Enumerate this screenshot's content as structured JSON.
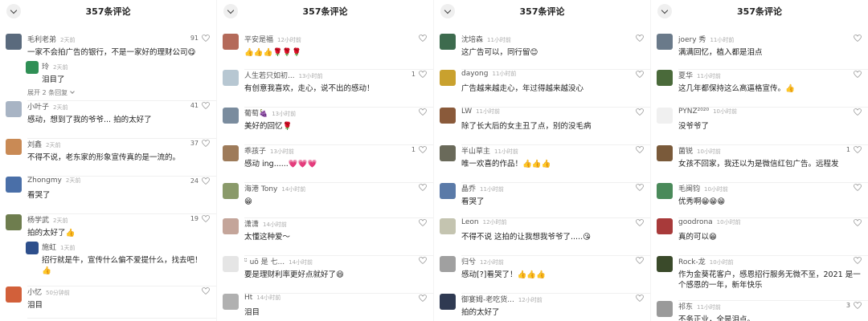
{
  "panels": [
    {
      "title": "357条评论",
      "comments": [
        {
          "user": "毛利老弟",
          "time": "2天前",
          "text": "一家不会拍广告的银行，不是一家好的理财公司😋",
          "likes": "91",
          "avatar_color": "#5a6a7d",
          "height": 84,
          "reply": {
            "user": "玲",
            "time": "2天前",
            "text": "泪目了",
            "avatar_color": "#2f8f55"
          },
          "expand": "展开 2 条回复"
        },
        {
          "user": "小叶子",
          "time": "2天前",
          "text": "感动，想到了我的爷爷... 拍的太好了",
          "likes": "41",
          "avatar_color": "#a8b4c4",
          "height": 47
        },
        {
          "user": "刘鑫",
          "time": "2天前",
          "text": "不得不说，老东家的形象宣传真的是一流的。",
          "likes": "37",
          "avatar_color": "#c98a55",
          "height": 47
        },
        {
          "user": "Zhongmy",
          "time": "2天前",
          "text": "看哭了",
          "likes": "24",
          "avatar_color": "#4a6fa8",
          "height": 47
        },
        {
          "user": "杨学武",
          "time": "2天前",
          "text": "拍的太好了👍",
          "likes": "19",
          "avatar_color": "#6e7d4e",
          "height": 90,
          "reply": {
            "user": "施虹",
            "time": "1天前",
            "text": "招行就是牛，宣传什么偏不爱提什么，找去吧！👍",
            "avatar_color": "#2d4f8c"
          }
        },
        {
          "user": "小忆",
          "time": "50分钟前",
          "text": "泪目",
          "likes": "",
          "avatar_color": "#d2603a",
          "height": 40
        }
      ]
    },
    {
      "title": "357条评论",
      "comments": [
        {
          "user": "平安是福",
          "time": "12小时前",
          "text": "👍👍👍🌹🌹🌹",
          "likes": "",
          "avatar_color": "#b46a5a",
          "height": 45
        },
        {
          "user": "人生若只如初...",
          "time": "13小时前",
          "text": "有创意我喜欢，走心，说不出的感动！",
          "likes": "1",
          "avatar_color": "#b7c7d2",
          "height": 47
        },
        {
          "user": "葡萄🍇",
          "time": "13小时前",
          "text": "美好的回忆🌹",
          "likes": "",
          "avatar_color": "#7a8c9e",
          "height": 47
        },
        {
          "user": "乖孩子",
          "time": "13小时前",
          "text": "感动 ing......💗💗💗",
          "likes": "1",
          "avatar_color": "#9e7b5a",
          "height": 47
        },
        {
          "user": "海港 Tony",
          "time": "14小时前",
          "text": "😁",
          "likes": "",
          "avatar_color": "#8a9a6a",
          "height": 44
        },
        {
          "user": "潇潇",
          "time": "14小时前",
          "text": "太懂这种爱～",
          "likes": "",
          "avatar_color": "#c4a59a",
          "height": 47
        },
        {
          "user": "ᵕ̈ uō 是 七...",
          "time": "14小时前",
          "text": "要是理财利率更好点就好了😆",
          "likes": "",
          "avatar_color": "#e5e5e5",
          "height": 47
        },
        {
          "user": "Ht",
          "time": "14小时前",
          "text": "泪目",
          "likes": "",
          "avatar_color": "#b0b0b0",
          "height": 40
        }
      ]
    },
    {
      "title": "357条评论",
      "comments": [
        {
          "user": "沈培森",
          "time": "11小时前",
          "text": "这广告可以，同行留😊",
          "likes": "",
          "avatar_color": "#3d6b4e",
          "height": 45
        },
        {
          "user": "dayong",
          "time": "11小时前",
          "text": "广告越来越走心，年过得越来越没心",
          "likes": "",
          "avatar_color": "#c9a12e",
          "height": 47
        },
        {
          "user": "LW",
          "time": "11小时前",
          "text": "除了长大后的女主丑了点，别的没毛病",
          "likes": "",
          "avatar_color": "#8a5a3a",
          "height": 47
        },
        {
          "user": "半山草主",
          "time": "11小时前",
          "text": "唯一欢喜的作品！👍👍👍",
          "likes": "",
          "avatar_color": "#6a6a5a",
          "height": 47
        },
        {
          "user": "晶乔",
          "time": "11小时前",
          "text": "看哭了",
          "likes": "",
          "avatar_color": "#5a7aa8",
          "height": 44
        },
        {
          "user": "Leon",
          "time": "12小时前",
          "text": "不得不说 这拍的让我想我爷爷了.....😘",
          "likes": "",
          "avatar_color": "#c4c4b0",
          "height": 47
        },
        {
          "user": "归兮",
          "time": "12小时前",
          "text": "感动[?]看哭了！👍👍👍",
          "likes": "",
          "avatar_color": "#a0a0a0",
          "height": 47
        },
        {
          "user": "御宴姆-老吃货...",
          "time": "12小时前",
          "text": "拍的太好了",
          "likes": "",
          "avatar_color": "#2f3a52",
          "height": 40
        }
      ]
    },
    {
      "title": "357条评论",
      "comments": [
        {
          "user": "joery 秀",
          "time": "11小时前",
          "text": "满满回忆，植入都是泪点",
          "likes": "",
          "avatar_color": "#6a7a8a",
          "height": 45
        },
        {
          "user": "夏华",
          "time": "11小时前",
          "text": "这几年都保持这么高逼格宣传。👍",
          "likes": "",
          "avatar_color": "#4a6a3a",
          "height": 47
        },
        {
          "user": "PYNZ²⁰²⁰",
          "time": "10小时前",
          "text": "没爷爷了",
          "likes": "",
          "avatar_color": "#f0f0f0",
          "height": 47
        },
        {
          "user": "菌锐",
          "time": "10小时前",
          "text": "女孩不回家，我还以为是微信红包广告。远程发",
          "likes": "1",
          "avatar_color": "#7a5a3a",
          "height": 47
        },
        {
          "user": "毛闽钧",
          "time": "10小时前",
          "text": "优秀啊😁😁😁",
          "likes": "",
          "avatar_color": "#4a8a5a",
          "height": 44
        },
        {
          "user": "goodrona",
          "time": "10小时前",
          "text": "真的可以😁",
          "likes": "",
          "avatar_color": "#a83a3a",
          "height": 47
        },
        {
          "user": "Rock-龙",
          "time": "10小时前",
          "text": "作为金葵花客户，感恩招行服务无微不至，2021 是一个感恩的一年，新年快乐",
          "likes": "",
          "avatar_color": "#3a4a2a",
          "height": 56
        },
        {
          "user": "祁东",
          "time": "11小时前",
          "text": "不务正业，全是泪点。",
          "likes": "3",
          "avatar_color": "#9a9a9a",
          "height": 40
        }
      ]
    }
  ]
}
